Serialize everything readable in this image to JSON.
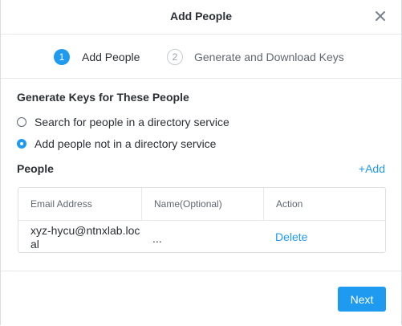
{
  "dialog": {
    "title": "Add People",
    "close_icon": "close-icon"
  },
  "stepper": {
    "steps": [
      {
        "number": "1",
        "label": "Add People",
        "active": true
      },
      {
        "number": "2",
        "label": "Generate and Download Keys",
        "active": false
      }
    ]
  },
  "generate_section": {
    "title": "Generate Keys for These People",
    "options": [
      {
        "label": "Search for people in a directory service",
        "selected": false
      },
      {
        "label": "Add people not in a directory service",
        "selected": true
      }
    ]
  },
  "people": {
    "title": "People",
    "add_label": "+Add",
    "columns": [
      "Email Address",
      "Name(Optional)",
      "Action"
    ],
    "rows": [
      {
        "email": "xyz-hycu@ntnxlab.local",
        "name": "...",
        "action": "Delete"
      }
    ]
  },
  "footer": {
    "next_label": "Next"
  },
  "colors": {
    "accent": "#1e9af0",
    "text": "#2b2f36",
    "muted": "#5f6773"
  }
}
